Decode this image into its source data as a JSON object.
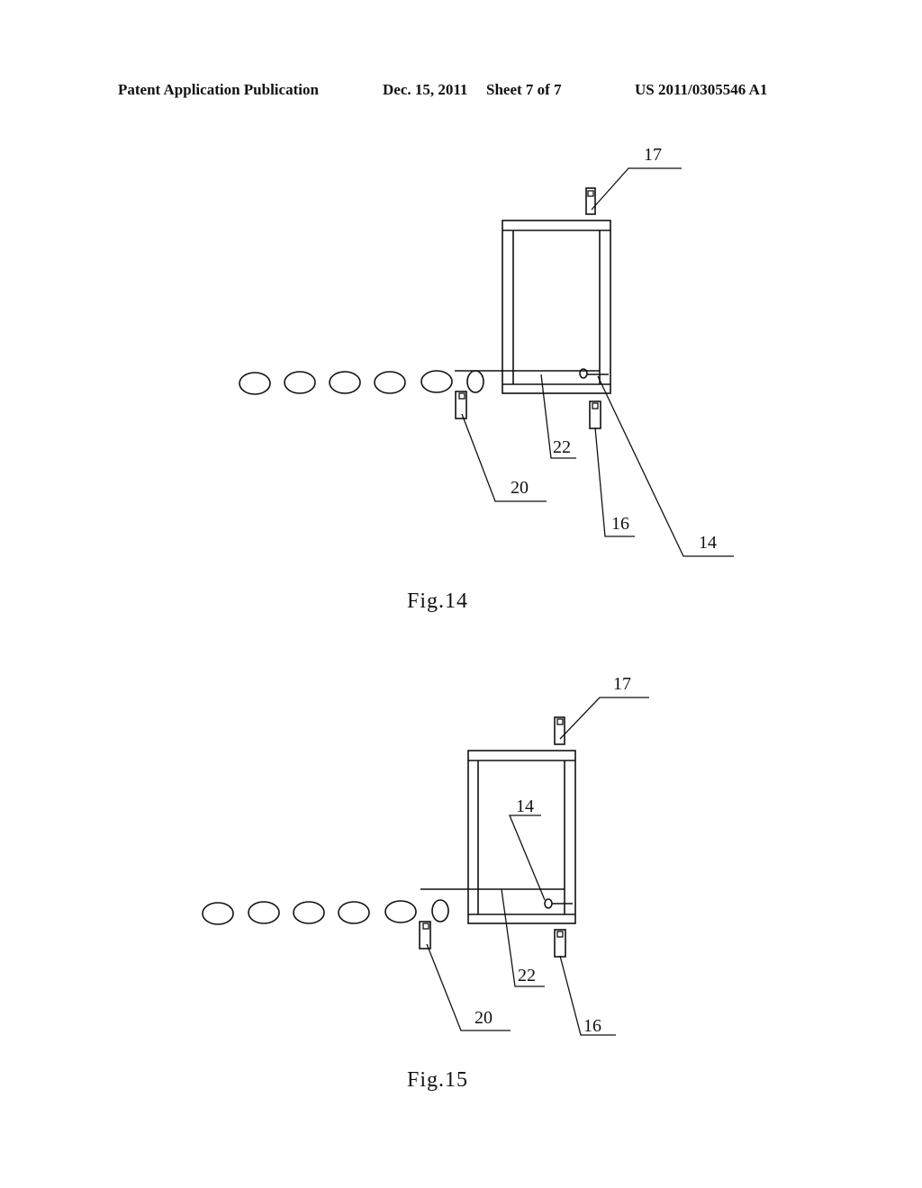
{
  "header": {
    "publication": "Patent Application Publication",
    "date": "Dec. 15, 2011",
    "sheet": "Sheet 7 of 7",
    "number": "US 2011/0305546 A1"
  },
  "figures": [
    {
      "caption": "Fig.14",
      "labels": {
        "sensor_top": "17",
        "sensor_entry": "20",
        "sensor_bottom": "16",
        "stopper": "22",
        "pivot": "14"
      },
      "queued_items_count": 6
    },
    {
      "caption": "Fig.15",
      "labels": {
        "sensor_top": "17",
        "sensor_entry": "20",
        "sensor_bottom": "16",
        "stopper": "22",
        "pivot": "14"
      },
      "queued_items_count": 6
    }
  ]
}
